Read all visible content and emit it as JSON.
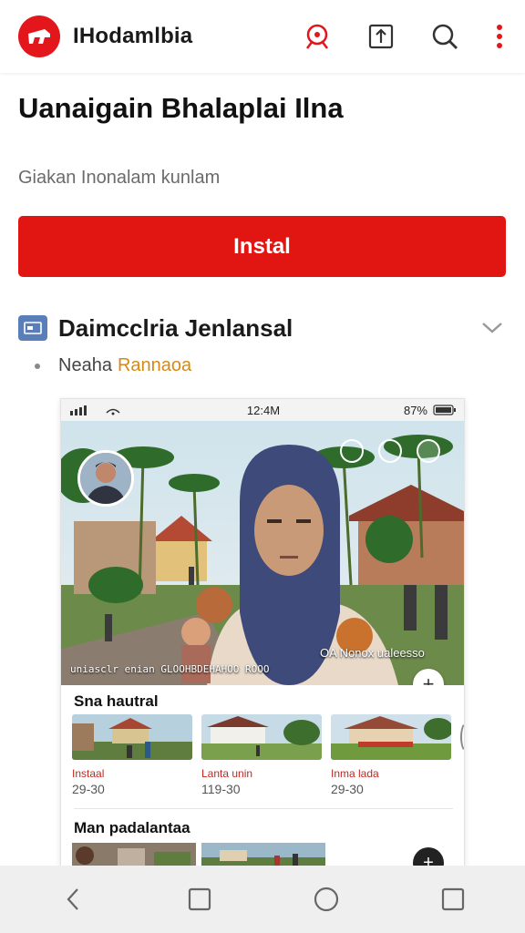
{
  "topbar": {
    "app_title": "IHodamlbia",
    "icons": [
      "app-logo-icon",
      "location-pin-icon",
      "share-box-icon",
      "search-icon",
      "more-vert-icon"
    ],
    "brand_color": "#e3161b"
  },
  "header": {
    "headline": "Uanaigain Bhalaplai Ilna",
    "subtitle": "Giakan Inonalam kunlam"
  },
  "install_button": {
    "label": "Instal",
    "color": "#e11512"
  },
  "section": {
    "title": "Daimcclria Jenlansal",
    "meta_label": "Neaha",
    "meta_highlight": "Rannaoa",
    "highlight_color": "#d68a16"
  },
  "preview": {
    "status_left": "",
    "status_time": "12:4M",
    "status_battery": "87%",
    "hero_tag": "OA Nonox ualeesso",
    "hero_caption": "uniasclr enian GLOOHBDEHAHOO ROOO",
    "row1_title": "Sna hautral",
    "row1_items": [
      {
        "label": "Instaal",
        "meta": "29-30"
      },
      {
        "label": "Lanta unin",
        "meta": "119-30"
      },
      {
        "label": "Inma lada",
        "meta": "29-30"
      }
    ],
    "row2_title": "Man padalantaa"
  },
  "navbar": {
    "icons": [
      "back-icon",
      "square-icon",
      "home-circle-icon",
      "recents-square-icon"
    ]
  }
}
